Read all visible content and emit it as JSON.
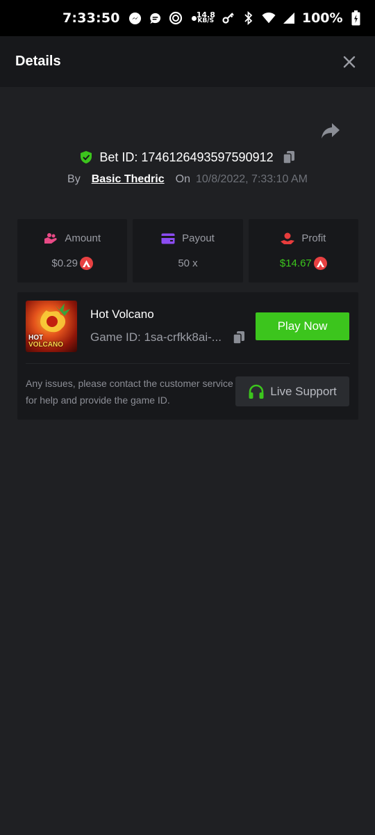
{
  "status_bar": {
    "time": "7:33:50",
    "net_speed_value": "14.8",
    "net_speed_unit": "KB/S",
    "battery": "100%",
    "icons": [
      "messenger-icon",
      "chat-icon",
      "app-icon",
      "key-icon",
      "bluetooth-icon",
      "wifi-icon",
      "signal-icon",
      "battery-icon"
    ]
  },
  "header": {
    "title": "Details",
    "close_icon": "close-icon"
  },
  "bet": {
    "id_label": "Bet ID:",
    "id_value": "1746126493597590912",
    "by_label": "By",
    "user": "Basic Thedric",
    "on_label": "On",
    "date": "10/8/2022, 7:33:10 AM"
  },
  "stats": {
    "amount_label": "Amount",
    "amount_value": "$0.29",
    "payout_label": "Payout",
    "payout_value": "50 x",
    "profit_label": "Profit",
    "profit_value": "$14.67"
  },
  "game": {
    "thumb_line1": "HOT",
    "thumb_line2": "VOLCANO",
    "name": "Hot Volcano",
    "id_text": "Game ID: 1sa-crfkk8ai-...",
    "play_label": "Play Now",
    "issue_text": "Any issues, please contact the customer service for help and provide the game ID.",
    "support_label": "Live Support"
  },
  "colors": {
    "background": "#1f2023",
    "panel": "#17181b",
    "accent_green": "#3cc51d",
    "coin_red": "#e84142"
  }
}
